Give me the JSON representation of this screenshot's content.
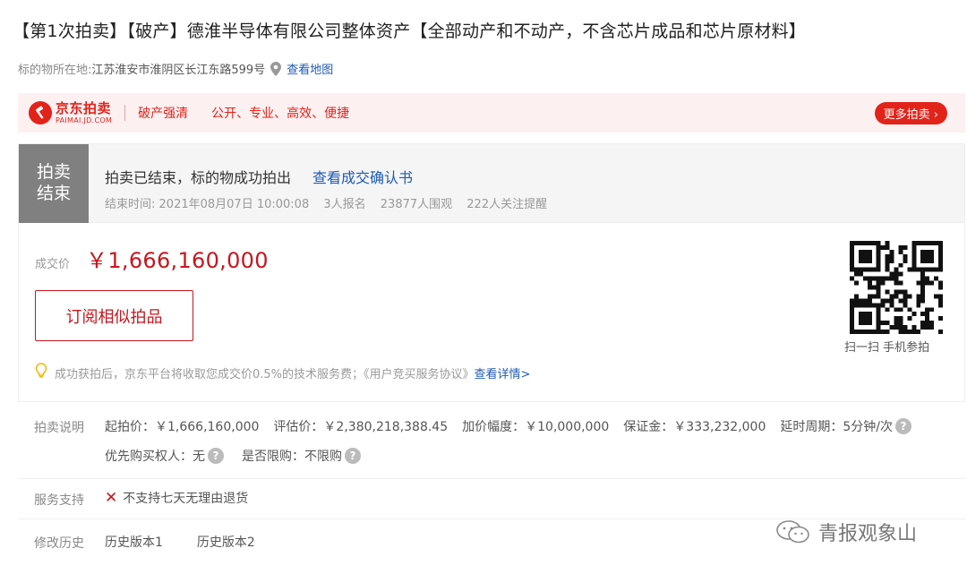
{
  "page": {
    "title": "【第1次拍卖】【破产】德淮半导体有限公司整体资产【全部动产和不动产，不含芯片成品和芯片原材料】"
  },
  "location": {
    "label": "标的物所在地:",
    "address": "江苏淮安市淮阴区长江东路599号",
    "map_link": "查看地图",
    "icon": "map-pin-icon"
  },
  "banner": {
    "brand_name": "京东拍卖",
    "brand_domain": "PAIMAI.JD.COM",
    "tag": "破产强清",
    "slogan": "公开、专业、高效、便捷",
    "more_button": "更多拍卖 ›",
    "accent_color": "#e2231a",
    "background_color": "#fdf0f1"
  },
  "status": {
    "tile_line1": "拍卖",
    "tile_line2": "结束",
    "message": "拍卖已结束，标的物成功拍出",
    "cert_link": "查看成交确认书",
    "end_time_label": "结束时间:",
    "end_time": "2021年08月07日 10:00:08",
    "signups": "3人报名",
    "viewers": "23877人围观",
    "followers": "222人关注提醒"
  },
  "deal": {
    "price_label": "成交价",
    "price": "￥1,666,160,000",
    "subscribe_button": "订阅相似拍品",
    "qr_caption": "扫一扫 手机参拍",
    "fee_note": "成功获拍后，京东平台将收取您成交价0.5%的技术服务费；《用户竞买服务协议》",
    "fee_link": "查看详情>",
    "price_color": "#c8161d"
  },
  "auction_info": {
    "label": "拍卖说明",
    "starting_price": "起拍价：￥1,666,160,000",
    "appraisal": "评估价：￥2,380,218,388.45",
    "increment": "加价幅度：￥10,000,000",
    "deposit": "保证金：￥333,232,000",
    "delay": "延时周期：5分钟/次",
    "priority": "优先购买权人：无",
    "restricted": "是否限购：不限购"
  },
  "service": {
    "label": "服务支持",
    "no_return": "不支持七天无理由退货"
  },
  "history": {
    "label": "修改历史",
    "versions": [
      "历史版本1",
      "历史版本2"
    ]
  },
  "watermark": {
    "text": "青报观象山"
  }
}
